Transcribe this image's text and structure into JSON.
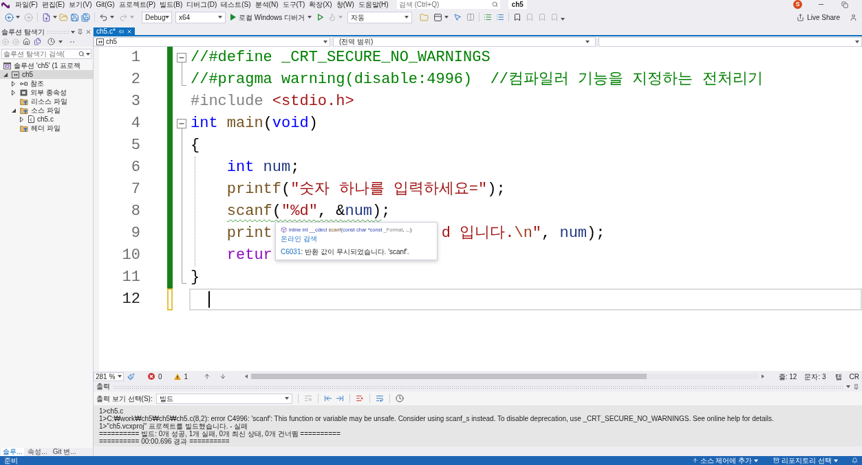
{
  "menu": [
    "파일(F)",
    "편집(E)",
    "보기(V)",
    "Git(G)",
    "프로젝트(P)",
    "빌드(B)",
    "디버그(D)",
    "테스트(S)",
    "분석(N)",
    "도구(T)",
    "확장(X)",
    "창(W)",
    "도움말(H)"
  ],
  "search": {
    "placeholder": "검색 (Ctrl+Q)"
  },
  "window": {
    "title": "ch5",
    "avatar": "S"
  },
  "toolbar": {
    "configuration": "Debug",
    "platform": "x64",
    "run_label": "로컬 Windows 디버거",
    "target": "자동",
    "live_share": "Live Share"
  },
  "solution_explorer": {
    "title": "솔루션 탐색기",
    "search": {
      "placeholder": "솔루션 탐색기 검색("
    },
    "tree": [
      {
        "label": "솔루션 'ch5' (1 프로젝",
        "kind": "solution",
        "selected": false,
        "children": [
          {
            "label": "ch5",
            "kind": "project",
            "expanded": true,
            "selected": true,
            "children": [
              {
                "label": "참조",
                "kind": "references",
                "expanded": false,
                "selected": false
              },
              {
                "label": "외부 종속성",
                "kind": "dependencies",
                "expanded": false,
                "selected": false
              },
              {
                "label": "리소스 파일",
                "kind": "filter",
                "selected": false
              },
              {
                "label": "소스 파일",
                "kind": "filter",
                "expanded": true,
                "selected": false,
                "children": [
                  {
                    "label": "ch5.c",
                    "kind": "c-file",
                    "expanded": false,
                    "selected": false
                  }
                ]
              },
              {
                "label": "헤더 파일",
                "kind": "filter",
                "selected": false
              }
            ]
          }
        ]
      }
    ],
    "tabs": [
      {
        "label": "솔루...",
        "selected": true
      },
      {
        "label": "속성...",
        "selected": false
      },
      {
        "label": "Git 변...",
        "selected": false
      }
    ]
  },
  "editor": {
    "tabs": [
      {
        "label": "ch5.c*",
        "selected": true
      }
    ],
    "nav": {
      "scope": "ch5",
      "region": "(전역 범위)"
    },
    "lines": [
      {
        "n": "1",
        "collapsible": true,
        "fold_end": false,
        "saved": true,
        "current": false,
        "code": [
          {
            "text": "//#define _CRT_SECURE_NO_WARNINGS",
            "kind": "comment"
          }
        ]
      },
      {
        "n": "2",
        "collapsible": false,
        "fold_end": true,
        "saved": true,
        "current": false,
        "code": [
          {
            "text": "//#pragma warning(disable:4996)  //컴파일러 기능을 지정하는 전처리기",
            "kind": "comment"
          }
        ]
      },
      {
        "n": "3",
        "collapsible": false,
        "fold_end": false,
        "saved": true,
        "current": false,
        "code": [
          {
            "text": "#include",
            "kind": "preprocessor"
          },
          {
            "text": " <stdio.h>",
            "kind": "string"
          }
        ]
      },
      {
        "n": "4",
        "collapsible": true,
        "fold_end": false,
        "saved": true,
        "current": false,
        "code": [
          {
            "text": "int",
            "kind": "keyword"
          },
          {
            "text": " main",
            "kind": "function"
          },
          {
            "text": "(",
            "kind": "plain"
          },
          {
            "text": "void",
            "kind": "keyword"
          },
          {
            "text": ")",
            "kind": "plain"
          }
        ]
      },
      {
        "n": "5",
        "collapsible": false,
        "fold_end": false,
        "saved": true,
        "current": false,
        "code": [
          {
            "text": "{",
            "kind": "plain"
          }
        ]
      },
      {
        "n": "6",
        "collapsible": false,
        "fold_end": false,
        "saved": true,
        "current": false,
        "code": [
          {
            "text": "    int",
            "kind": "keyword"
          },
          {
            "text": " num",
            "kind": "variable"
          },
          {
            "text": ";",
            "kind": "plain"
          }
        ]
      },
      {
        "n": "7",
        "collapsible": false,
        "fold_end": false,
        "saved": true,
        "current": false,
        "code": [
          {
            "text": "    printf",
            "kind": "function"
          },
          {
            "text": "(",
            "kind": "plain"
          },
          {
            "text": "\"숫자 하나를 입력하세요=\"",
            "kind": "string"
          },
          {
            "text": ");",
            "kind": "plain"
          }
        ]
      },
      {
        "n": "8",
        "collapsible": false,
        "fold_end": false,
        "saved": true,
        "current": false,
        "code": [
          {
            "text": "    scanf",
            "kind": "function",
            "squiggle": true
          },
          {
            "text": "(",
            "kind": "plain",
            "squiggle": true
          },
          {
            "text": "\"%d\"",
            "kind": "string",
            "squiggle": true
          },
          {
            "text": ", &",
            "kind": "plain",
            "squiggle": true
          },
          {
            "text": "num",
            "kind": "variable",
            "squiggle": true
          },
          {
            "text": ")",
            "kind": "plain",
            "squiggle": true
          },
          {
            "text": ";",
            "kind": "plain",
            "squiggle": false
          }
        ]
      },
      {
        "n": "9",
        "collapsible": false,
        "fold_end": false,
        "saved": true,
        "current": false,
        "code": [
          {
            "text": "    print",
            "kind": "function"
          }
        ],
        "code_after_popup": [
          {
            "text": "d 입니다.",
            "kind": "string"
          },
          {
            "text": "\\n",
            "kind": "escape"
          },
          {
            "text": "\"",
            "kind": "string"
          },
          {
            "text": ", ",
            "kind": "plain"
          },
          {
            "text": "num",
            "kind": "variable"
          },
          {
            "text": ");",
            "kind": "plain"
          }
        ]
      },
      {
        "n": "10",
        "collapsible": false,
        "fold_end": false,
        "saved": true,
        "current": false,
        "code": [
          {
            "text": "    retur",
            "kind": "control"
          }
        ]
      },
      {
        "n": "11",
        "collapsible": false,
        "fold_end": true,
        "saved": true,
        "current": false,
        "code": [
          {
            "text": "}",
            "kind": "plain"
          }
        ]
      },
      {
        "n": "12",
        "collapsible": false,
        "fold_end": false,
        "saved": false,
        "current": true
      }
    ],
    "popup": {
      "signature": [
        {
          "text": "inline int __cdecl ",
          "kind": "keyword"
        },
        {
          "text": "scanf",
          "kind": "name"
        },
        {
          "text": "(const char *const ",
          "kind": "keyword"
        },
        {
          "text": "_Format",
          "kind": "param"
        },
        {
          "text": ", ...)",
          "kind": "plain"
        }
      ],
      "link": "온라인 검색",
      "code": "C6031",
      "message": ": 반환 값이 무시되었습니다. 'scanf'."
    },
    "status": {
      "zoom": "281 %",
      "errors": "0",
      "warnings": "1",
      "line": "줄: 12",
      "column": "문자: 3",
      "indent": "탭",
      "eol": "CR"
    }
  },
  "output": {
    "title": "출력",
    "source_label": "출력 보기 선택(S):",
    "source": "빌드",
    "lines": [
      "1>ch5.c",
      "1>C:₩work₩ch5₩ch5₩ch5.c(8,2): error C4996: 'scanf': This function or variable may be unsafe. Consider using scanf_s instead. To disable deprecation, use _CRT_SECURE_NO_WARNINGS. See online help for details.",
      "1>\"ch5.vcxproj\" 프로젝트를 빌드했습니다. - 실패",
      "========== 빌드: 0개 성공, 1개 실패, 0개 최신 상태, 0개 건너뜀 ==========",
      "========== 00:00.696 경과 =========="
    ]
  },
  "status_bar": {
    "state": "준비",
    "source_control": "소스 제어에 추가",
    "repository": "리포지토리 선택"
  }
}
